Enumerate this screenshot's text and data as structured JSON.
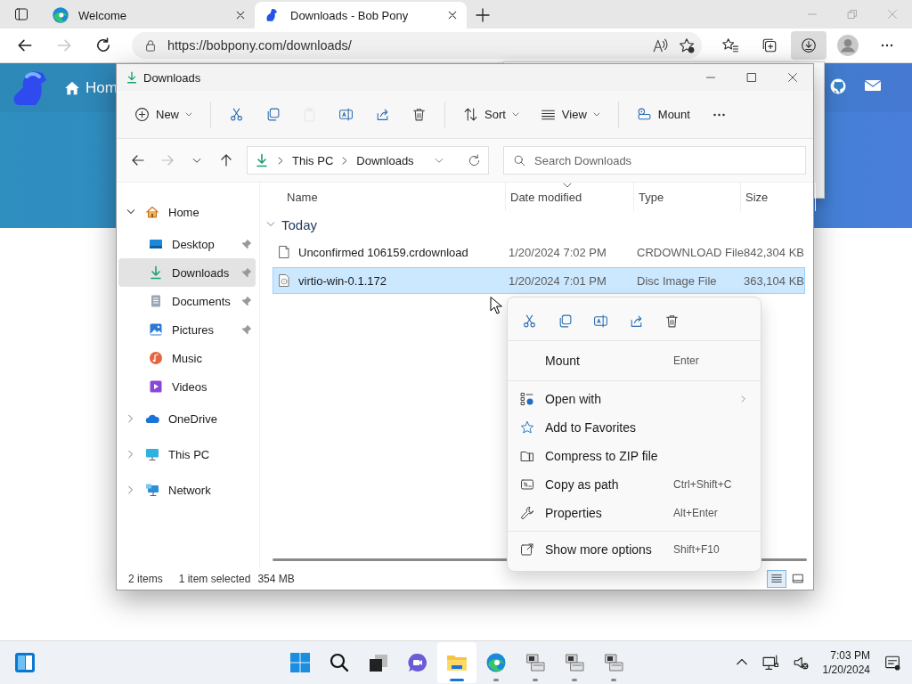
{
  "browser": {
    "tabs": [
      {
        "title": "Welcome",
        "selected": false
      },
      {
        "title": "Downloads - Bob Pony",
        "selected": true
      }
    ],
    "address": "https://bobpony.com/downloads/",
    "forward_disabled": true,
    "downloads_open": true
  },
  "website": {
    "nav_label": "Hom"
  },
  "explorer": {
    "title": "Downloads",
    "commands": [
      {
        "kind": "new",
        "label": "New",
        "disabled": false
      },
      {
        "kind": "cut",
        "disabled": false
      },
      {
        "kind": "copy",
        "disabled": false
      },
      {
        "kind": "paste",
        "disabled": true
      },
      {
        "kind": "rename",
        "disabled": false
      },
      {
        "kind": "share",
        "disabled": false
      },
      {
        "kind": "delete",
        "disabled": false
      },
      {
        "kind": "sort",
        "label": "Sort",
        "disabled": false
      },
      {
        "kind": "view",
        "label": "View",
        "disabled": false
      },
      {
        "kind": "mount",
        "label": "Mount",
        "disabled": false
      },
      {
        "kind": "more",
        "disabled": false
      }
    ],
    "forward_disabled": true,
    "breadcrumb": [
      "This PC",
      "Downloads"
    ],
    "search": {
      "placeholder": "Search Downloads"
    },
    "sidebar": [
      {
        "kind": "home",
        "label": "Home",
        "expanded": true,
        "selected": false,
        "children": [
          {
            "kind": "desktop",
            "label": "Desktop",
            "pinned": true,
            "selected": false
          },
          {
            "kind": "downloads",
            "label": "Downloads",
            "pinned": true,
            "selected": true
          },
          {
            "kind": "documents",
            "label": "Documents",
            "pinned": true,
            "selected": false
          },
          {
            "kind": "pictures",
            "label": "Pictures",
            "pinned": true,
            "selected": false
          },
          {
            "kind": "music",
            "label": "Music",
            "pinned": false,
            "selected": false
          },
          {
            "kind": "videos",
            "label": "Videos",
            "pinned": false,
            "selected": false
          }
        ]
      },
      {
        "kind": "onedrive",
        "label": "OneDrive",
        "expanded": false,
        "selected": false
      },
      {
        "kind": "pc",
        "label": "This PC",
        "expanded": false,
        "selected": false
      },
      {
        "kind": "network",
        "label": "Network",
        "expanded": false,
        "selected": false
      }
    ],
    "columns": [
      {
        "label": "Name",
        "sorted": false
      },
      {
        "label": "Date modified",
        "sorted": true
      },
      {
        "label": "Type",
        "sorted": false
      },
      {
        "label": "Size",
        "sorted": false
      }
    ],
    "groups": [
      {
        "label": "Today",
        "expanded": true,
        "rows": [
          {
            "kind": "file",
            "name": "Unconfirmed 106159.crdownload",
            "date": "1/20/2024 7:02 PM",
            "type": "CRDOWNLOAD File",
            "size": "842,304 KB",
            "selected": false
          },
          {
            "kind": "disc",
            "name": "virtio-win-0.1.172",
            "date": "1/20/2024 7:01 PM",
            "type": "Disc Image File",
            "size": "363,104 KB",
            "selected": true
          }
        ]
      }
    ],
    "status": {
      "count": "2 items",
      "selection": "1 item selected",
      "size": "354 MB"
    },
    "view_modes": [
      {
        "kind": "details",
        "selected": true
      },
      {
        "kind": "tiles",
        "selected": false
      }
    ]
  },
  "context_menu": {
    "sections": [
      {
        "items": [
          {
            "kind": "mount",
            "label": "Mount",
            "shortcut": "Enter",
            "submenu": false
          }
        ]
      },
      {
        "items": [
          {
            "kind": "open_with",
            "label": "Open with",
            "submenu": true
          },
          {
            "kind": "favorite",
            "label": "Add to Favorites",
            "submenu": false
          },
          {
            "kind": "zip",
            "label": "Compress to ZIP file",
            "submenu": false
          },
          {
            "kind": "copy_path",
            "label": "Copy as path",
            "shortcut": "Ctrl+Shift+C",
            "submenu": false
          },
          {
            "kind": "properties",
            "label": "Properties",
            "shortcut": "Alt+Enter",
            "submenu": false
          }
        ]
      },
      {
        "items": [
          {
            "kind": "more_options",
            "label": "Show more options",
            "shortcut": "Shift+F10",
            "submenu": false
          }
        ]
      }
    ]
  },
  "taskbar": {
    "apps": [
      {
        "kind": "start",
        "open": false,
        "focused": false
      },
      {
        "kind": "search",
        "open": false,
        "focused": false
      },
      {
        "kind": "taskview",
        "open": false,
        "focused": false
      },
      {
        "kind": "chat",
        "open": false,
        "focused": false
      },
      {
        "kind": "explorer",
        "open": true,
        "focused": true
      },
      {
        "kind": "edge",
        "open": true,
        "focused": false
      },
      {
        "kind": "vm",
        "open": true,
        "focused": false
      },
      {
        "kind": "vm",
        "open": true,
        "focused": false
      },
      {
        "kind": "vm",
        "open": true,
        "focused": false
      }
    ],
    "clock": {
      "time": "7:03 PM",
      "date": "1/20/2024"
    }
  }
}
